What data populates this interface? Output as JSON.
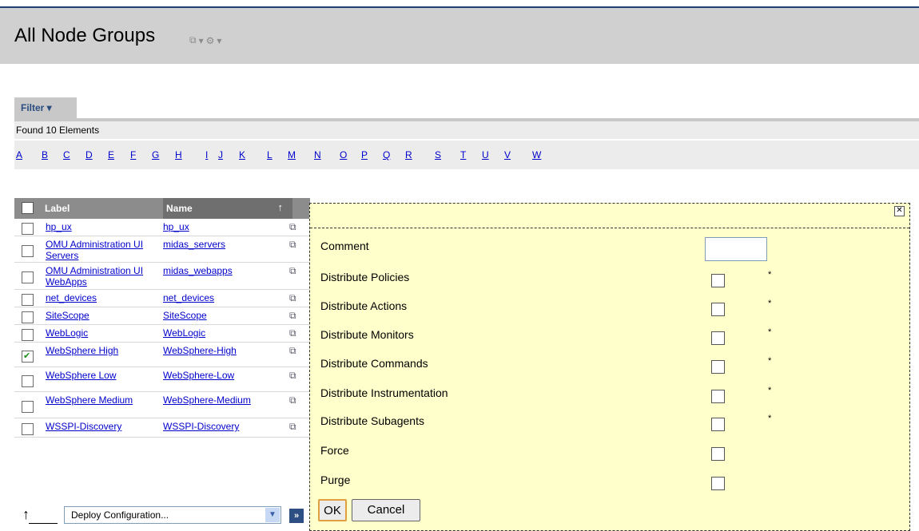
{
  "header": {
    "title": "All Node Groups"
  },
  "filter": {
    "label": "Filter ▾",
    "found_text": "Found 10 Elements"
  },
  "letters": [
    "A",
    "B",
    "C",
    "D",
    "E",
    "F",
    "G",
    "H",
    "I",
    "J",
    "K",
    "L",
    "M",
    "N",
    "O",
    "P",
    "Q",
    "R",
    "S",
    "T",
    "U",
    "V",
    "W"
  ],
  "grid": {
    "headers": {
      "label": "Label",
      "name": "Name"
    },
    "rows": [
      {
        "label": "hp_ux",
        "name": "hp_ux",
        "checked": false
      },
      {
        "label": "OMU Administration UI Servers",
        "name": "midas_servers",
        "checked": false
      },
      {
        "label": "OMU Administration UI WebApps",
        "name": "midas_webapps",
        "checked": false
      },
      {
        "label": "net_devices",
        "name": "net_devices",
        "checked": false
      },
      {
        "label": "SiteScope",
        "name": "SiteScope",
        "checked": false
      },
      {
        "label": "WebLogic",
        "name": "WebLogic",
        "checked": false
      },
      {
        "label": "WebSphere High",
        "name": "WebSphere-High",
        "checked": true
      },
      {
        "label": "WebSphere Low",
        "name": "WebSphere-Low",
        "checked": false
      },
      {
        "label": "WebSphere Medium",
        "name": "WebSphere-Medium",
        "checked": false
      },
      {
        "label": "WSSPI-Discovery",
        "name": "WSSPI-Discovery",
        "checked": false
      }
    ]
  },
  "footer": {
    "action_select": "Deploy Configuration...",
    "go": "»"
  },
  "popup": {
    "comment_label": "Comment",
    "options": [
      {
        "label": "Distribute Policies",
        "required": true
      },
      {
        "label": "Distribute Actions",
        "required": true
      },
      {
        "label": "Distribute Monitors",
        "required": true
      },
      {
        "label": "Distribute Commands",
        "required": true
      },
      {
        "label": "Distribute Instrumentation",
        "required": true
      },
      {
        "label": "Distribute Subagents",
        "required": true
      },
      {
        "label": "Force",
        "required": false
      },
      {
        "label": "Purge",
        "required": false
      }
    ],
    "required_mark": "*",
    "ok": "OK",
    "cancel": "Cancel"
  },
  "colors": {
    "header_bg": "#d0d0d0",
    "popup_bg": "#ffffcc",
    "link": "#0000cc",
    "grid_header": "#8c8c8c"
  }
}
